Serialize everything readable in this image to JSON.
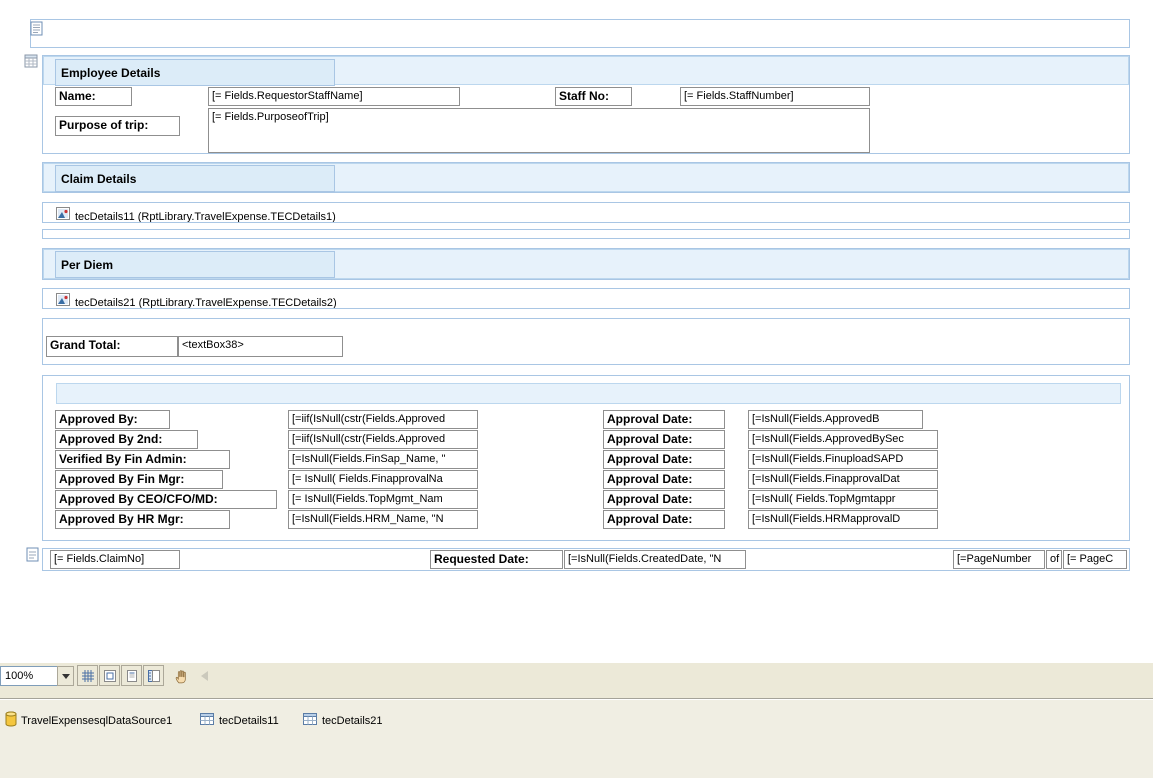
{
  "employee": {
    "title": "Employee Details",
    "name_label": "Name:",
    "name_value": "[= Fields.RequestorStaffName]",
    "staff_label": "Staff No:",
    "staff_value": "[= Fields.StaffNumber]",
    "purpose_label": "Purpose of trip:",
    "purpose_value": "[= Fields.PurposeofTrip]"
  },
  "claim": {
    "title": "Claim Details",
    "subreport": "tecDetails11 (RptLibrary.TravelExpense.TECDetails1)"
  },
  "perdiem": {
    "title": "Per Diem",
    "subreport": "tecDetails21 (RptLibrary.TravelExpense.TECDetails2)"
  },
  "grand_total": {
    "label": "Grand Total:",
    "value": "<textBox38>"
  },
  "approvals": {
    "rows": [
      {
        "label": "Approved By:",
        "value": "[=iif(IsNull(cstr(Fields.Approved",
        "date_label": "Approval Date:",
        "date_value": "[=IsNull(Fields.ApprovedB"
      },
      {
        "label": "Approved By 2nd:",
        "value": "[=iif(IsNull(cstr(Fields.Approved",
        "date_label": "Approval Date:",
        "date_value": "[=IsNull(Fields.ApprovedBySec"
      },
      {
        "label": "Verified By Fin Admin:",
        "value": "[=IsNull(Fields.FinSap_Name, \"",
        "date_label": "Approval Date:",
        "date_value": "[=IsNull(Fields.FinuploadSAPD"
      },
      {
        "label": "Approved By Fin Mgr:",
        "value": "[= IsNull( Fields.FinapprovalNa",
        "date_label": "Approval Date:",
        "date_value": "[=IsNull(Fields.FinapprovalDat"
      },
      {
        "label": "Approved By CEO/CFO/MD:",
        "value": "[= IsNull(Fields.TopMgmt_Nam",
        "date_label": "Approval Date:",
        "date_value": "[=IsNull( Fields.TopMgmtappr"
      },
      {
        "label": "Approved By HR Mgr:",
        "value": "[=IsNull(Fields.HRM_Name, \"N",
        "date_label": "Approval Date:",
        "date_value": "[=IsNull(Fields.HRMapprovalD"
      }
    ]
  },
  "footer": {
    "claim_no": "[= Fields.ClaimNo]",
    "requested_label": "Requested Date:",
    "requested_value": "[=IsNull(Fields.CreatedDate, \"N",
    "page_number": "[=PageNumber",
    "of_label": "of",
    "page_count": "[= PageC"
  },
  "statusbar": {
    "zoom": "100%",
    "buttons": [
      {
        "icon": "grid-icon"
      },
      {
        "icon": "page-corners-icon"
      },
      {
        "icon": "page-icon"
      },
      {
        "icon": "ruler-icon"
      },
      {
        "icon": "hand-icon"
      },
      {
        "icon": "back-arrow-icon"
      }
    ]
  },
  "tray": {
    "items": [
      {
        "label": "TravelExpensesqlDataSource1",
        "icon": "database-icon"
      },
      {
        "label": "tecDetails11",
        "icon": "table-icon"
      },
      {
        "label": "tecDetails21",
        "icon": "table-icon"
      }
    ]
  }
}
